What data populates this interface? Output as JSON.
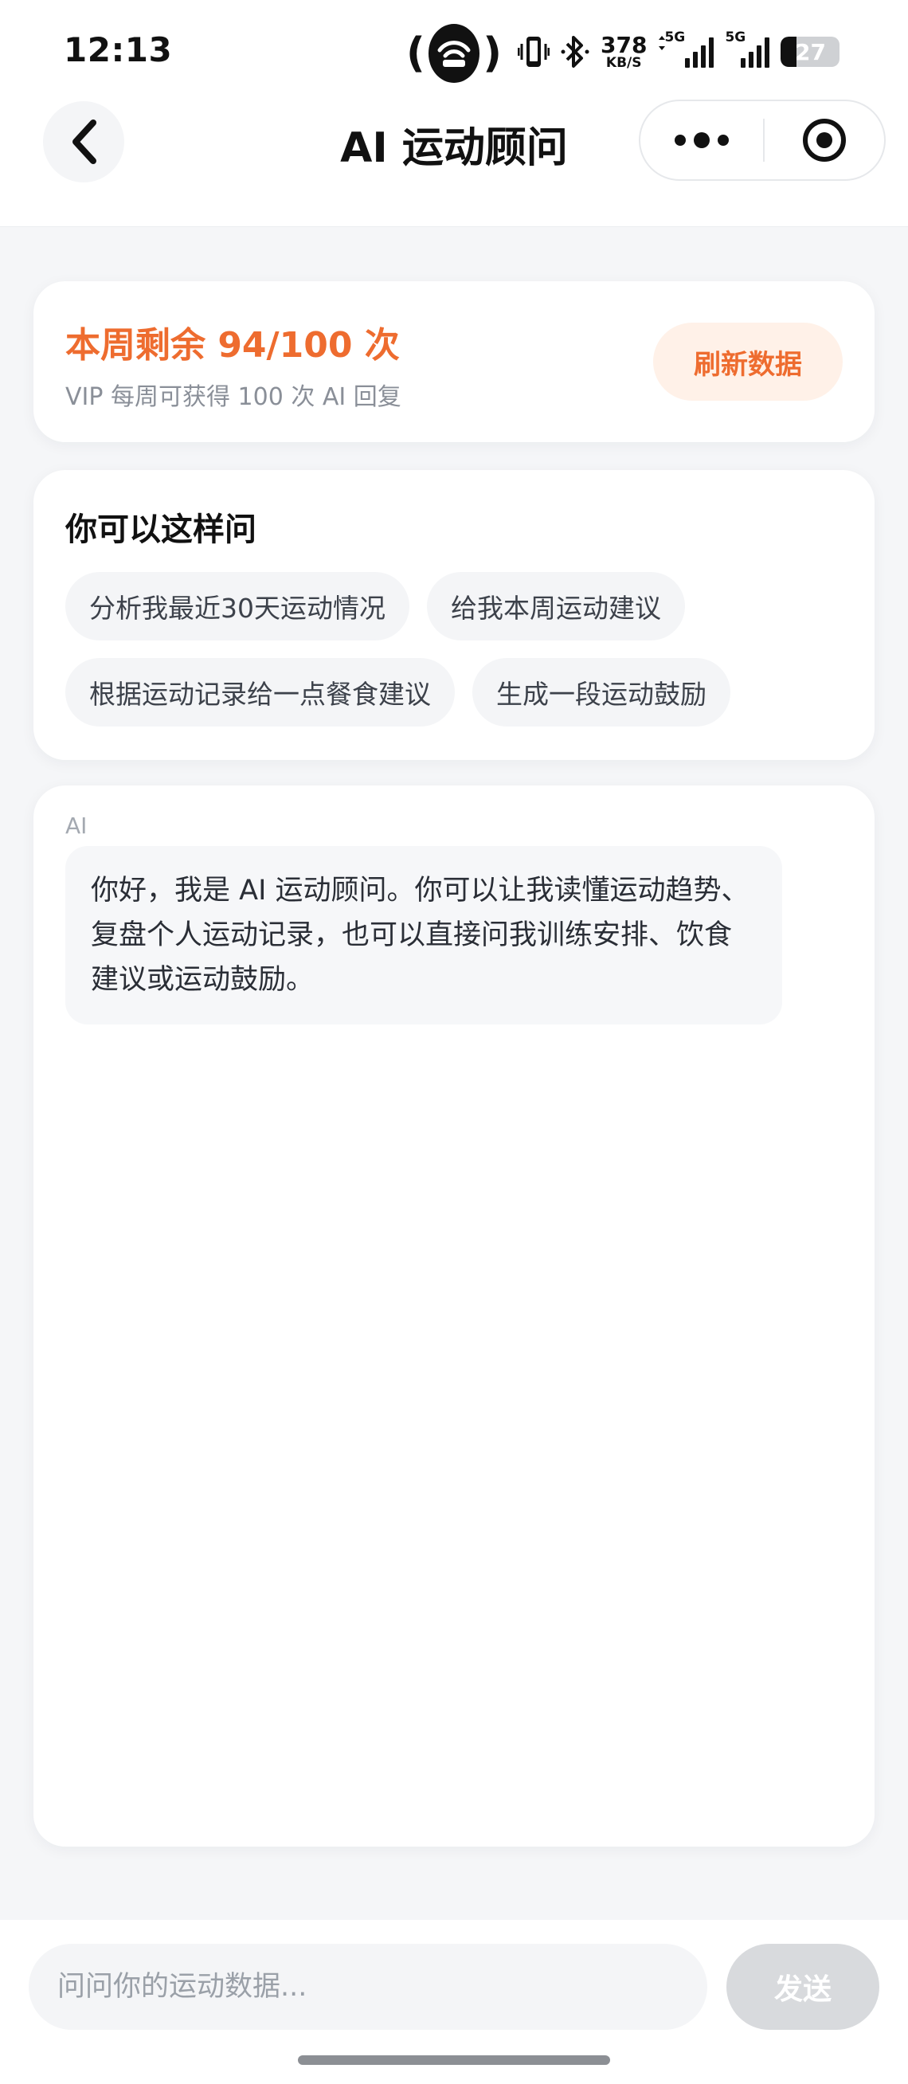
{
  "status_bar": {
    "time": "12:13",
    "net_speed_value": "378",
    "net_speed_unit": "KB/S",
    "sim1_tag": "5G",
    "sim2_tag": "5G",
    "battery_level": "27",
    "battery_fraction": 0.27
  },
  "nav": {
    "title": "AI 运动顾问"
  },
  "quota": {
    "title": "本周剩余 94/100 次",
    "subtitle": "VIP 每周可获得 100 次 AI 回复",
    "refresh_label": "刷新数据"
  },
  "suggestions": {
    "title": "你可以这样问",
    "chips": [
      "分析我最近30天运动情况",
      "给我本周运动建议",
      "根据运动记录给一点餐食建议",
      "生成一段运动鼓励"
    ]
  },
  "chat": {
    "sender_label": "AI",
    "message": "你好，我是 AI 运动顾问。你可以让我读懂运动趋势、复盘个人运动记录，也可以直接问我训练安排、饮食建议或运动鼓励。"
  },
  "input": {
    "placeholder": "问问你的运动数据...",
    "value": "",
    "send_label": "发送"
  },
  "colors": {
    "accent": "#ee6c2f",
    "accent_soft": "#fff1e8",
    "send_disabled": "#d8dadd"
  },
  "icons": {
    "hotspot": "hotspot-icon",
    "vibrate": "vibrate-icon",
    "bluetooth": "bluetooth-icon",
    "back": "chevron-left-icon",
    "more": "more-dots-icon",
    "target": "target-icon"
  }
}
